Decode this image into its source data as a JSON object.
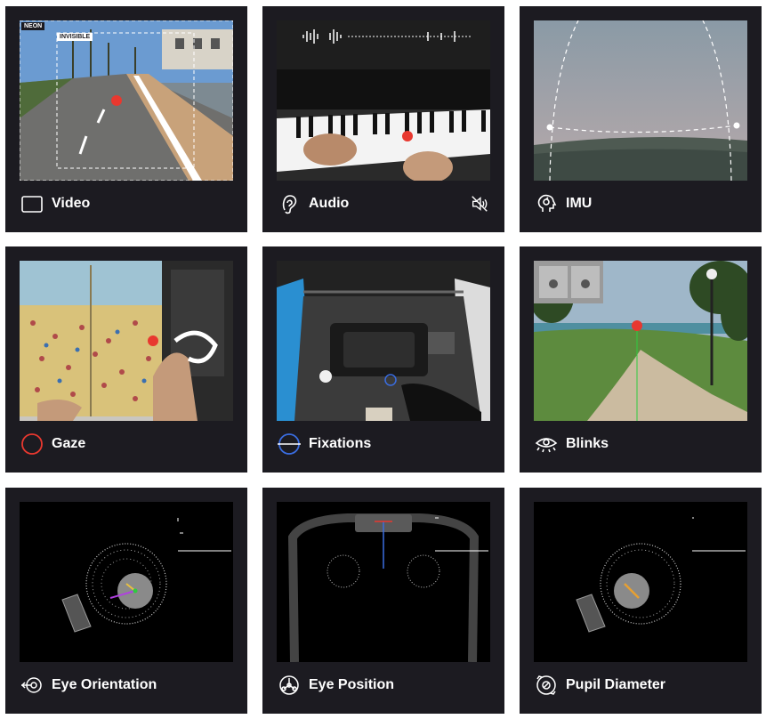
{
  "cards": [
    {
      "id": "video",
      "label": "Video",
      "icon": "square-icon",
      "overlay": {
        "tag1": "NEON",
        "tag2": "INVISIBLE"
      }
    },
    {
      "id": "audio",
      "label": "Audio",
      "icon": "ear-icon",
      "right_icon": "mute-icon"
    },
    {
      "id": "imu",
      "label": "IMU",
      "icon": "head-rotation-icon"
    },
    {
      "id": "gaze",
      "label": "Gaze",
      "icon": "red-circle-icon"
    },
    {
      "id": "fixations",
      "label": "Fixations",
      "icon": "fixation-circle-icon"
    },
    {
      "id": "blinks",
      "label": "Blinks",
      "icon": "eye-blink-icon"
    },
    {
      "id": "eye_orientation",
      "label": "Eye Orientation",
      "icon": "eye-orientation-icon"
    },
    {
      "id": "eye_position",
      "label": "Eye Position",
      "icon": "eye-position-icon"
    },
    {
      "id": "pupil_diameter",
      "label": "Pupil Diameter",
      "icon": "pupil-diameter-icon"
    }
  ],
  "colors": {
    "card_bg": "#1c1b21",
    "gaze_red": "#e8382f",
    "fixation_blue": "#3a6de0"
  }
}
